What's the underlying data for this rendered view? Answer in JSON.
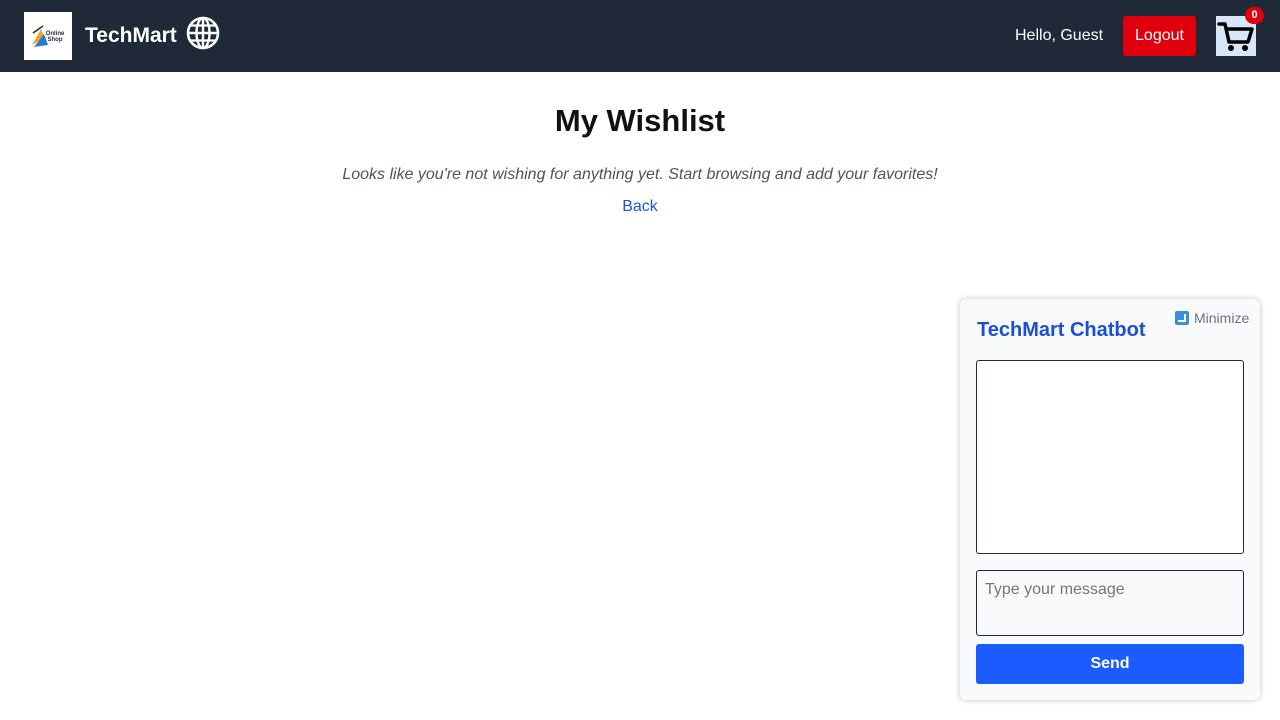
{
  "header": {
    "logo_text": "Online\nShop",
    "brand": "TechMart",
    "greeting": "Hello, Guest",
    "logout_label": "Logout",
    "cart_count": "0",
    "icons": {
      "language": "globe-icon",
      "cart": "cart-icon"
    },
    "colors": {
      "background": "#1f2937",
      "logout": "#e0000d"
    }
  },
  "main": {
    "title": "My Wishlist",
    "empty_message": "Looks like you're not wishing for anything yet. Start browsing and add your favorites!",
    "back_link": "Back"
  },
  "chatbot": {
    "minimize_label": "Minimize",
    "title": "TechMart Chatbot",
    "input_placeholder": "Type your message",
    "send_label": "Send",
    "colors": {
      "title": "#1d4ed8",
      "send": "#1a5cff"
    }
  }
}
